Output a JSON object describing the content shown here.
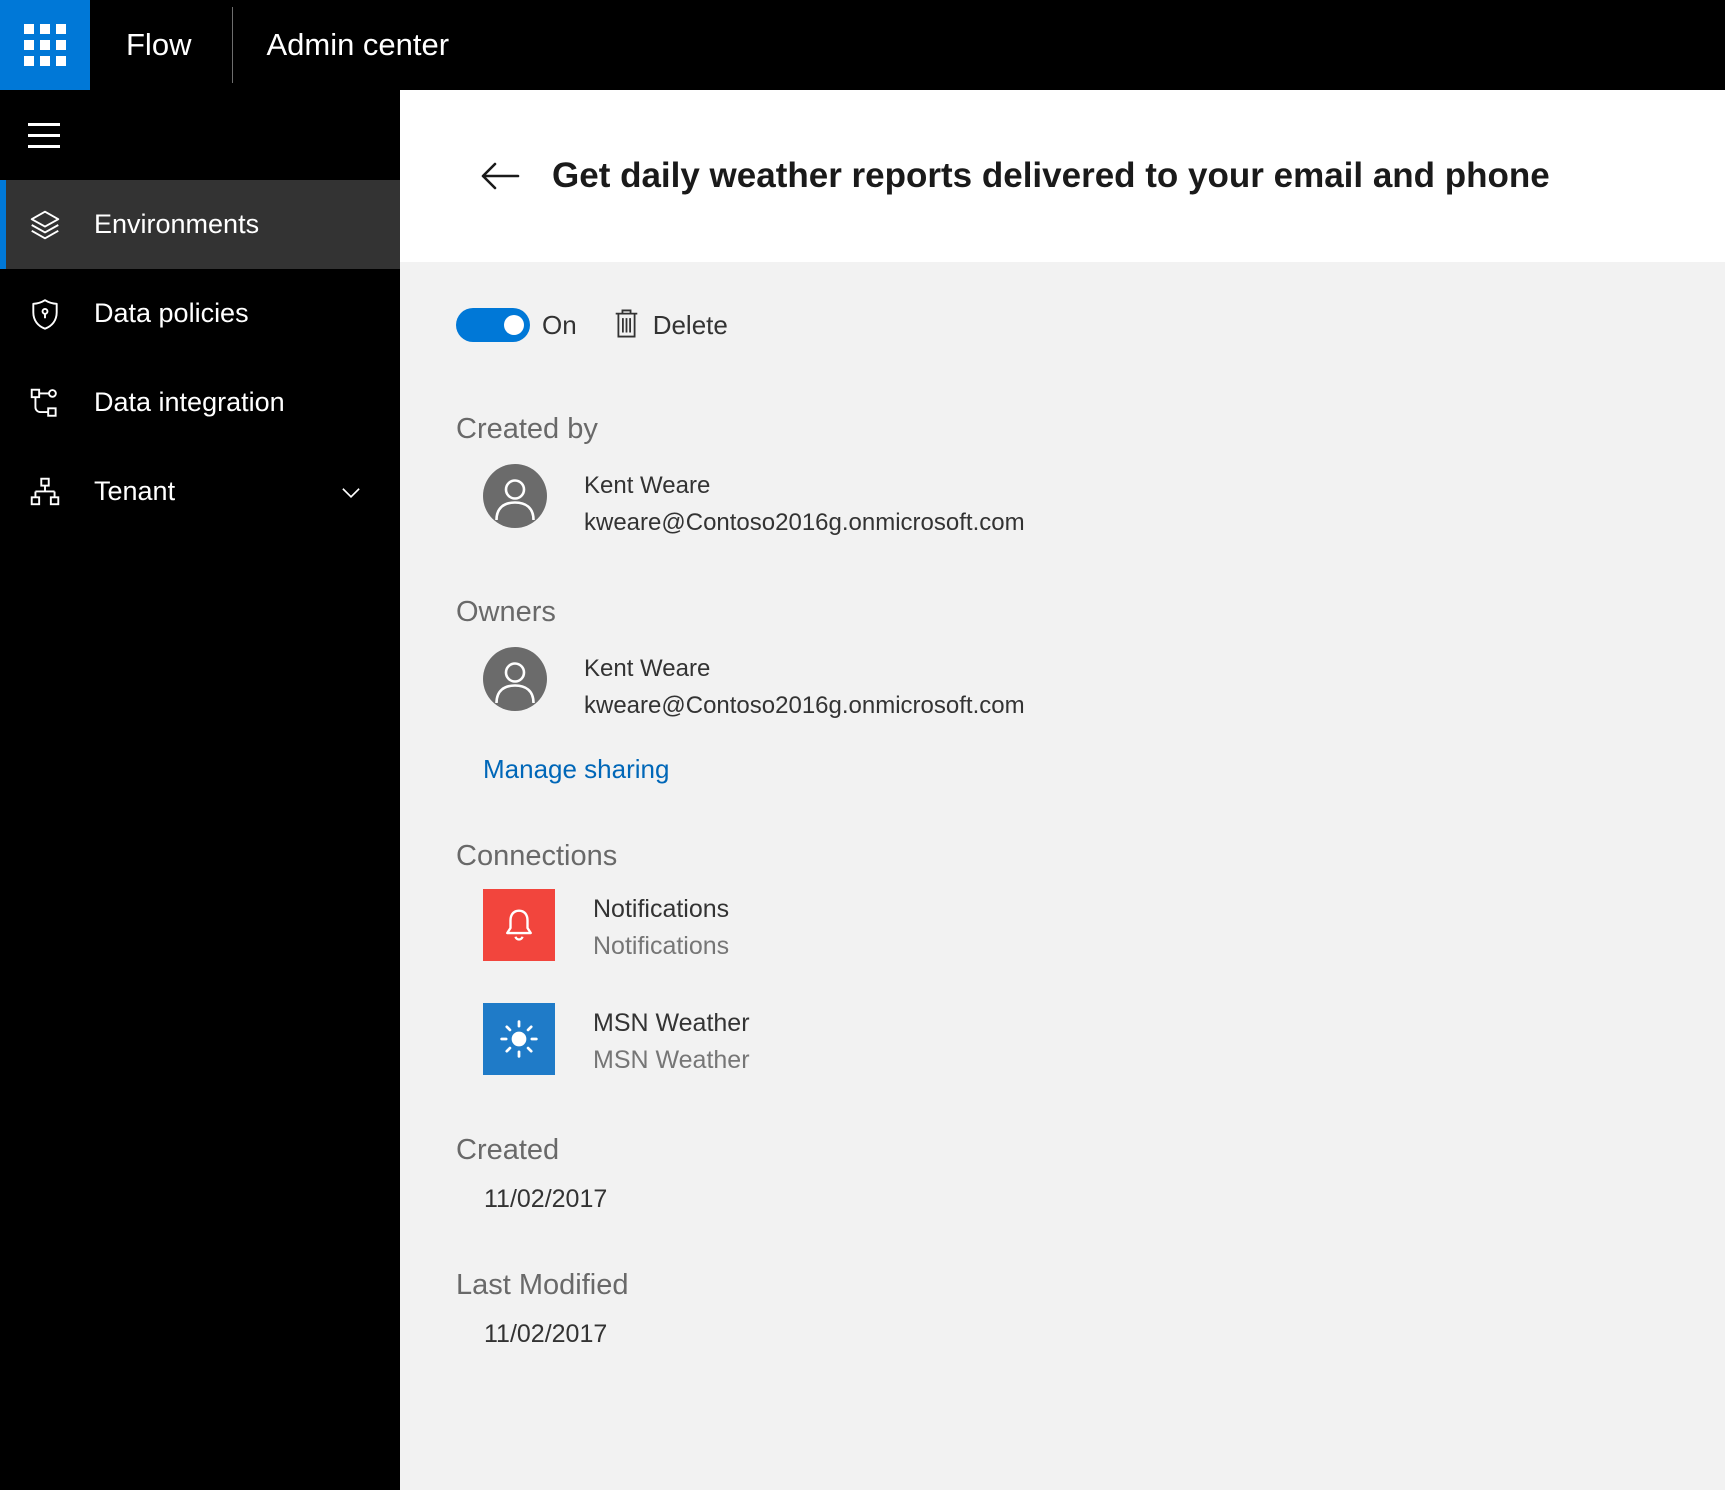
{
  "topbar": {
    "app_name": "Flow",
    "admin_center_label": "Admin center"
  },
  "sidebar": {
    "items": [
      {
        "label": "Environments",
        "icon": "layers-icon",
        "selected": true
      },
      {
        "label": "Data policies",
        "icon": "shield-icon",
        "selected": false
      },
      {
        "label": "Data integration",
        "icon": "integration-icon",
        "selected": false
      },
      {
        "label": "Tenant",
        "icon": "org-chart-icon",
        "selected": false,
        "has_submenu": true
      }
    ]
  },
  "header": {
    "title": "Get daily weather reports delivered to your email and phone"
  },
  "toolbar": {
    "toggle_on": true,
    "toggle_state_label": "On",
    "delete_label": "Delete"
  },
  "sections": {
    "created_by": {
      "heading": "Created by",
      "person": {
        "name": "Kent Weare",
        "email": "kweare@Contoso2016g.onmicrosoft.com"
      }
    },
    "owners": {
      "heading": "Owners",
      "person": {
        "name": "Kent Weare",
        "email": "kweare@Contoso2016g.onmicrosoft.com"
      },
      "manage_sharing_label": "Manage sharing"
    },
    "connections": {
      "heading": "Connections",
      "items": [
        {
          "name": "Notifications",
          "service": "Notifications",
          "icon": "bell-icon",
          "tile_color": "#f2453d"
        },
        {
          "name": "MSN Weather",
          "service": "MSN Weather",
          "icon": "sun-icon",
          "tile_color": "#1f7bc8"
        }
      ]
    },
    "created": {
      "heading": "Created",
      "value": "11/02/2017"
    },
    "last_modified": {
      "heading": "Last Modified",
      "value": "11/02/2017"
    }
  },
  "colors": {
    "accent_blue": "#0078d7",
    "link_blue": "#0067b8",
    "notifications_red": "#f2453d",
    "msn_weather_blue": "#1f7bc8",
    "content_background": "#f2f2f2",
    "sidebar_background": "#000000"
  }
}
